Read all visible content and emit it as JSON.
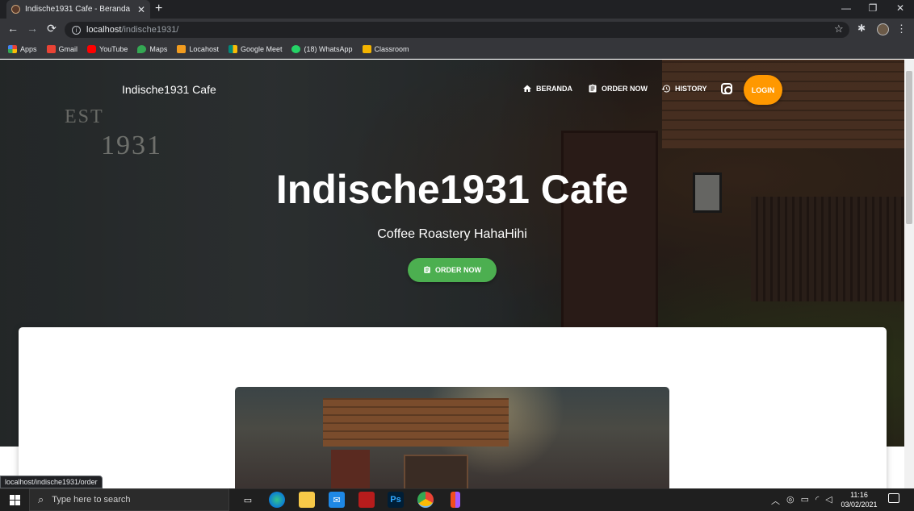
{
  "browser": {
    "tab_title": "Indische1931 Cafe - Beranda",
    "tab_close": "✕",
    "new_tab": "+",
    "url_host": "localhost",
    "url_path": "/indische1931/",
    "window_controls": [
      "—",
      "❐",
      "✕"
    ],
    "status_url": "localhost/indische1931/order"
  },
  "bookmarks": [
    {
      "label": "Apps",
      "icon": "apps-grid-icon",
      "color": "#ea4335"
    },
    {
      "label": "Gmail",
      "icon": "gmail-icon",
      "color": "#ea4335"
    },
    {
      "label": "YouTube",
      "icon": "youtube-icon",
      "color": "#ff0000"
    },
    {
      "label": "Maps",
      "icon": "maps-pin-icon",
      "color": "#34a853"
    },
    {
      "label": "Locahost",
      "icon": "xampp-icon",
      "color": "#f29c1f"
    },
    {
      "label": "Google Meet",
      "icon": "meet-icon",
      "color": "#00897b"
    },
    {
      "label": "(18) WhatsApp",
      "icon": "whatsapp-icon",
      "color": "#25d366"
    },
    {
      "label": "Classroom",
      "icon": "classroom-icon",
      "color": "#f4b400"
    }
  ],
  "site": {
    "brand": "Indische1931 Cafe",
    "nav": {
      "home": "BERANDA",
      "order": "ORDER NOW",
      "history": "HISTORY",
      "login": "LOGIN"
    },
    "hero": {
      "wall_text_1": "EST",
      "wall_text_2": "1931",
      "title": "Indische1931 Cafe",
      "subtitle": "Coffee Roastery HahaHihi",
      "cta": "ORDER NOW"
    },
    "colors": {
      "login": "#ff9800",
      "cta": "#4caf50"
    }
  },
  "taskbar": {
    "search_placeholder": "Type here to search",
    "time": "11:16",
    "date": "03/02/2021",
    "apps": [
      "task-view-icon",
      "edge-icon",
      "file-explorer-icon",
      "mail-icon",
      "app-red-icon",
      "photoshop-icon",
      "chrome-icon",
      "figma-icon"
    ],
    "ps_label": "Ps"
  }
}
